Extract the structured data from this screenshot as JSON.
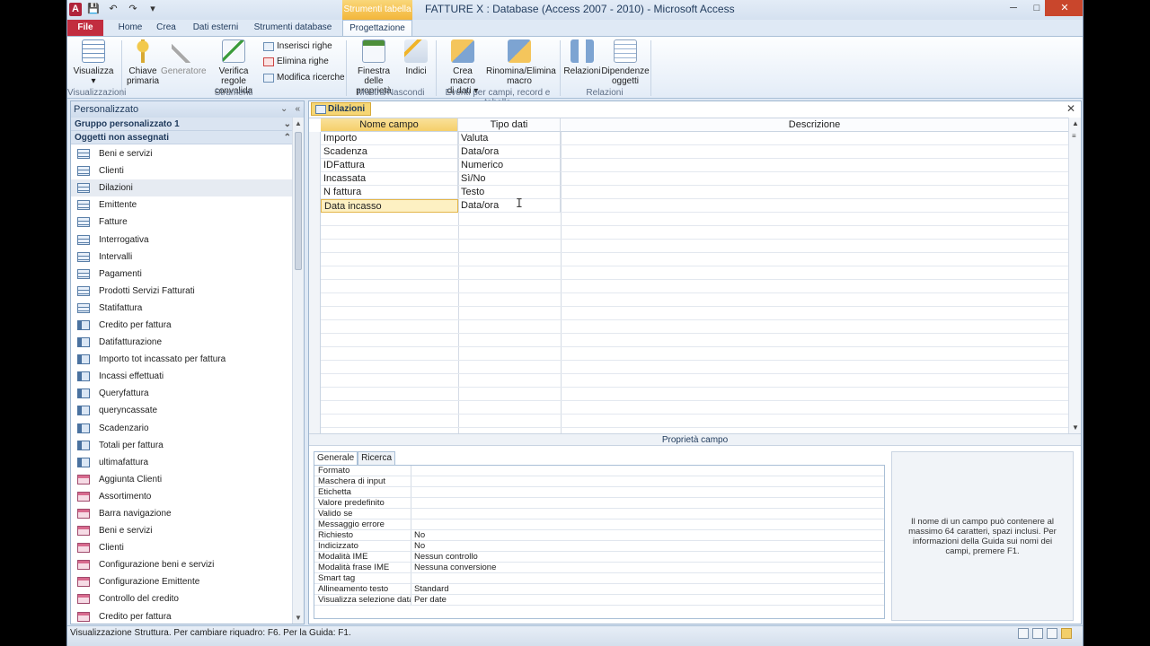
{
  "window": {
    "title": "FATTURE X : Database (Access 2007 - 2010)  -  Microsoft Access",
    "contextual_label": "Strumenti tabella",
    "app_icon_letter": "A",
    "minimize": "─",
    "maximize": "□",
    "close": "✕"
  },
  "ribbon_tabs": {
    "file": "File",
    "home": "Home",
    "crea": "Crea",
    "dati_esterni": "Dati esterni",
    "strumenti_database": "Strumenti database",
    "progettazione": "Progettazione"
  },
  "ribbon": {
    "visualizza": "Visualizza",
    "chiave_primaria_1": "Chiave",
    "chiave_primaria_2": "primaria",
    "generatore": "Generatore",
    "verifica_1": "Verifica regole",
    "verifica_2": "convalida",
    "inserisci_righe": "Inserisci righe",
    "elimina_righe": "Elimina righe",
    "modifica_ricerche": "Modifica ricerche",
    "finestra_1": "Finestra delle",
    "finestra_2": "proprietà",
    "indici": "Indici",
    "crea_macro_1": "Crea macro",
    "crea_macro_2": "di dati ▾",
    "rinomina_1": "Rinomina/Elimina",
    "rinomina_2": "macro",
    "relazioni": "Relazioni",
    "dipendenze_1": "Dipendenze",
    "dipendenze_2": "oggetti",
    "groups": {
      "visualizzazioni": "Visualizzazioni",
      "strumenti": "Strumenti",
      "mostra": "Mostra/Nascondi",
      "eventi": "Eventi per campi, record e tabelle",
      "relazioni": "Relazioni"
    }
  },
  "nav": {
    "header": "Personalizzato",
    "group1": "Gruppo personalizzato 1",
    "group2": "Oggetti non assegnati",
    "items": [
      {
        "label": "Beni e servizi",
        "type": "table"
      },
      {
        "label": "Clienti",
        "type": "table"
      },
      {
        "label": "Dilazioni",
        "type": "table",
        "selected": true
      },
      {
        "label": "Emittente",
        "type": "table"
      },
      {
        "label": "Fatture",
        "type": "table"
      },
      {
        "label": "Interrogativa",
        "type": "table"
      },
      {
        "label": "Intervalli",
        "type": "table"
      },
      {
        "label": "Pagamenti",
        "type": "table"
      },
      {
        "label": "Prodotti Servizi Fatturati",
        "type": "table"
      },
      {
        "label": "Statifattura",
        "type": "table"
      },
      {
        "label": "Credito per fattura",
        "type": "query"
      },
      {
        "label": "Datifatturazione",
        "type": "query"
      },
      {
        "label": "Importo tot incassato per fattura",
        "type": "query"
      },
      {
        "label": "Incassi effettuati",
        "type": "query"
      },
      {
        "label": "Queryfattura",
        "type": "query"
      },
      {
        "label": "queryncassate",
        "type": "query"
      },
      {
        "label": "Scadenzario",
        "type": "query"
      },
      {
        "label": "Totali per fattura",
        "type": "query"
      },
      {
        "label": "ultimafattura",
        "type": "query"
      },
      {
        "label": "Aggiunta Clienti",
        "type": "form"
      },
      {
        "label": "Assortimento",
        "type": "form"
      },
      {
        "label": "Barra navigazione",
        "type": "form"
      },
      {
        "label": "Beni e servizi",
        "type": "form"
      },
      {
        "label": "Clienti",
        "type": "form"
      },
      {
        "label": "Configurazione beni e servizi",
        "type": "form"
      },
      {
        "label": "Configurazione Emittente",
        "type": "form"
      },
      {
        "label": "Controllo del credito",
        "type": "form"
      },
      {
        "label": "Credito per fattura",
        "type": "form"
      }
    ]
  },
  "design": {
    "tab_label": "Dilazioni",
    "columns": {
      "name": "Nome campo",
      "type": "Tipo dati",
      "desc": "Descrizione"
    },
    "rows": [
      {
        "name": "Importo",
        "type": "Valuta"
      },
      {
        "name": "Scadenza",
        "type": "Data/ora"
      },
      {
        "name": "IDFattura",
        "type": "Numerico"
      },
      {
        "name": "Incassata",
        "type": "Sì/No"
      },
      {
        "name": "N fattura",
        "type": "Testo"
      },
      {
        "name": "Data incasso",
        "type": "Data/ora"
      }
    ]
  },
  "props": {
    "header": "Proprietà campo",
    "tab_generale": "Generale",
    "tab_ricerca": "Ricerca",
    "rows": [
      {
        "k": "Formato",
        "v": ""
      },
      {
        "k": "Maschera di input",
        "v": ""
      },
      {
        "k": "Etichetta",
        "v": ""
      },
      {
        "k": "Valore predefinito",
        "v": ""
      },
      {
        "k": "Valido se",
        "v": ""
      },
      {
        "k": "Messaggio errore",
        "v": ""
      },
      {
        "k": "Richiesto",
        "v": "No"
      },
      {
        "k": "Indicizzato",
        "v": "No"
      },
      {
        "k": "Modalità IME",
        "v": "Nessun controllo"
      },
      {
        "k": "Modalità frase IME",
        "v": "Nessuna conversione"
      },
      {
        "k": "Smart tag",
        "v": ""
      },
      {
        "k": "Allineamento testo",
        "v": "Standard"
      },
      {
        "k": "Visualizza selezione data",
        "v": "Per date"
      }
    ],
    "help_text": "Il nome di un campo può contenere al massimo 64 caratteri, spazi inclusi. Per informazioni della Guida sui nomi dei campi, premere F1."
  },
  "status": {
    "text": "Visualizzazione Struttura.  Per cambiare riquadro: F6.  Per la Guida: F1."
  }
}
